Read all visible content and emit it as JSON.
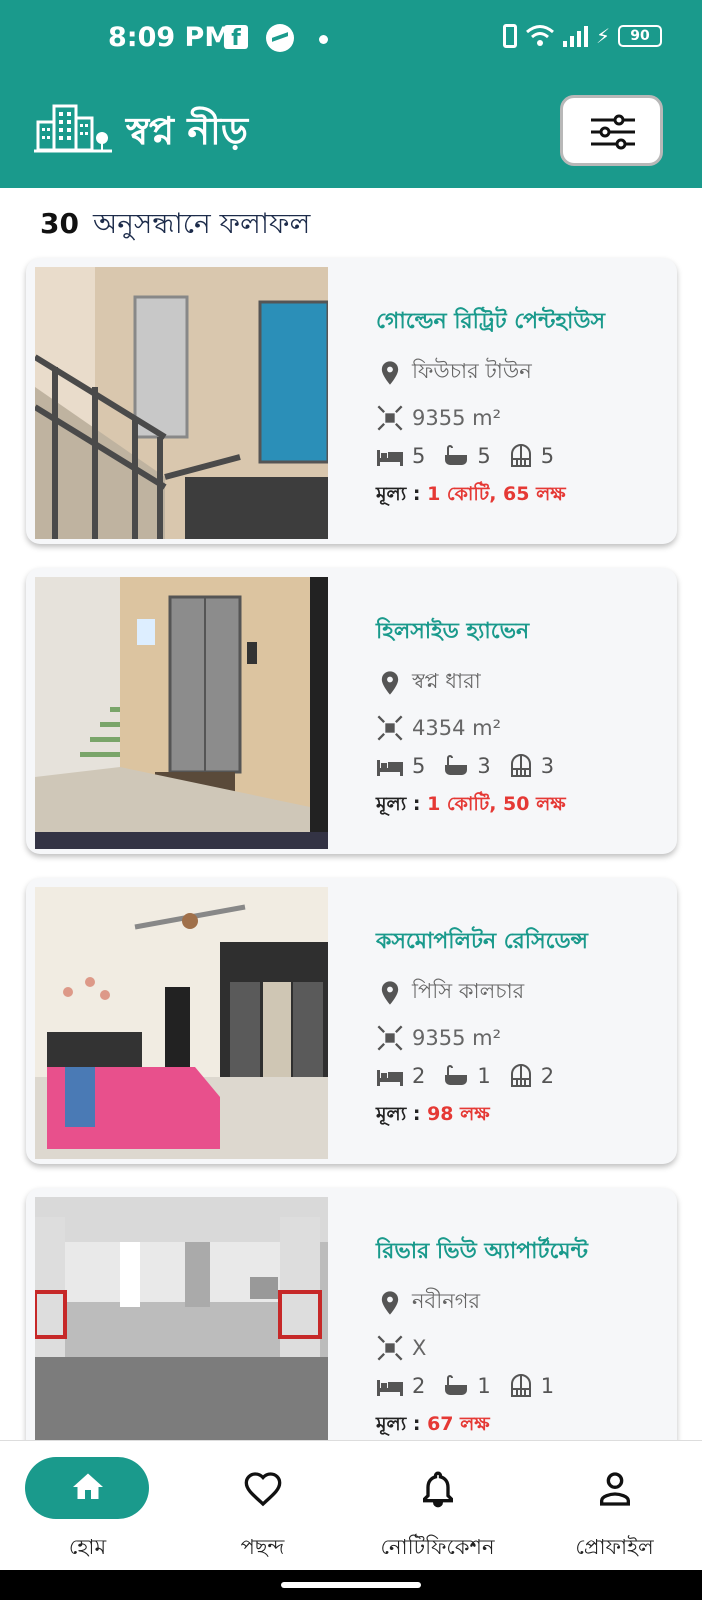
{
  "status_bar": {
    "time": "8:09 PM",
    "fb": "f",
    "battery": "90"
  },
  "app": {
    "title": "স্বপ্ন নীড়"
  },
  "results": {
    "count": "30",
    "label": "অনুসন্ধানে ফলাফল"
  },
  "price_label": "মূল্য :",
  "listings": [
    {
      "title": "গোল্ডেন রিট্রিট পেন্টহাউস",
      "location": "ফিউচার টাউন",
      "area": "9355 m²",
      "beds": "5",
      "baths": "5",
      "balconies": "5",
      "price": "1 কোটি, 65 লক্ষ"
    },
    {
      "title": "হিলসাইড হ্যাভেন",
      "location": "স্বপ্ন ধারা",
      "area": "4354 m²",
      "beds": "5",
      "baths": "3",
      "balconies": "3",
      "price": "1 কোটি, 50 লক্ষ"
    },
    {
      "title": "কসমোপলিটন রেসিডেন্স",
      "location": "পিসি কালচার",
      "area": "9355 m²",
      "beds": "2",
      "baths": "1",
      "balconies": "2",
      "price": "98 লক্ষ"
    },
    {
      "title": "রিভার ভিউ অ্যাপার্টমেন্ট",
      "location": "নবীনগর",
      "area": "X",
      "beds": "2",
      "baths": "1",
      "balconies": "1",
      "price": "67 লক্ষ"
    }
  ],
  "nav": {
    "home": "হোম",
    "favorites": "পছন্দ",
    "notifications": "নোটিফিকেশন",
    "profile": "প্রোফাইল"
  },
  "colors": {
    "primary": "#1a9a8c",
    "price": "#e53935"
  }
}
